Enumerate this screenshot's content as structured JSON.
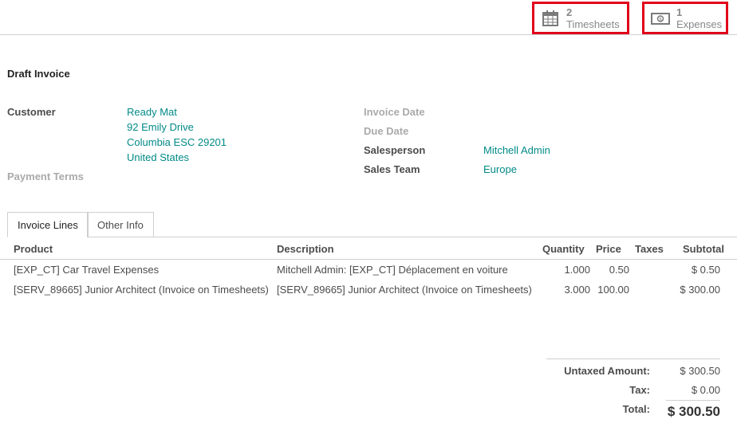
{
  "smart_buttons": {
    "timesheets": {
      "count": "2",
      "label": "Timesheets",
      "icon": "calendar-icon"
    },
    "expenses": {
      "count": "1",
      "label": "Expenses",
      "icon": "money-icon"
    }
  },
  "invoice": {
    "title": "Draft Invoice",
    "customer_label": "Customer",
    "customer_lines": [
      "Ready Mat",
      "92 Emily Drive",
      "Columbia ESC 29201",
      "United States"
    ],
    "payment_terms_label": "Payment Terms",
    "invoice_date_label": "Invoice Date",
    "due_date_label": "Due Date",
    "salesperson_label": "Salesperson",
    "salesperson_value": "Mitchell Admin",
    "sales_team_label": "Sales Team",
    "sales_team_value": "Europe"
  },
  "tabs": [
    {
      "label": "Invoice Lines",
      "active": true
    },
    {
      "label": "Other Info",
      "active": false
    }
  ],
  "table": {
    "headers": {
      "product": "Product",
      "description": "Description",
      "quantity": "Quantity",
      "price": "Price",
      "taxes": "Taxes",
      "subtotal": "Subtotal"
    },
    "rows": [
      {
        "product": "[EXP_CT] Car Travel Expenses",
        "description": "Mitchell Admin: [EXP_CT] Déplacement en voiture",
        "quantity": "1.000",
        "price": "0.50",
        "taxes": "",
        "subtotal": "$ 0.50"
      },
      {
        "product": "[SERV_89665] Junior Architect (Invoice on Timesheets)",
        "description": "[SERV_89665] Junior Architect (Invoice on Timesheets)",
        "quantity": "3.000",
        "price": "100.00",
        "taxes": "",
        "subtotal": "$ 300.00"
      }
    ]
  },
  "totals": {
    "untaxed_label": "Untaxed Amount:",
    "untaxed_value": "$ 300.50",
    "tax_label": "Tax:",
    "tax_value": "$ 0.00",
    "total_label": "Total:",
    "total_value": "$ 300.50"
  },
  "colors": {
    "link": "#018a87",
    "highlight": "#e0001b"
  }
}
